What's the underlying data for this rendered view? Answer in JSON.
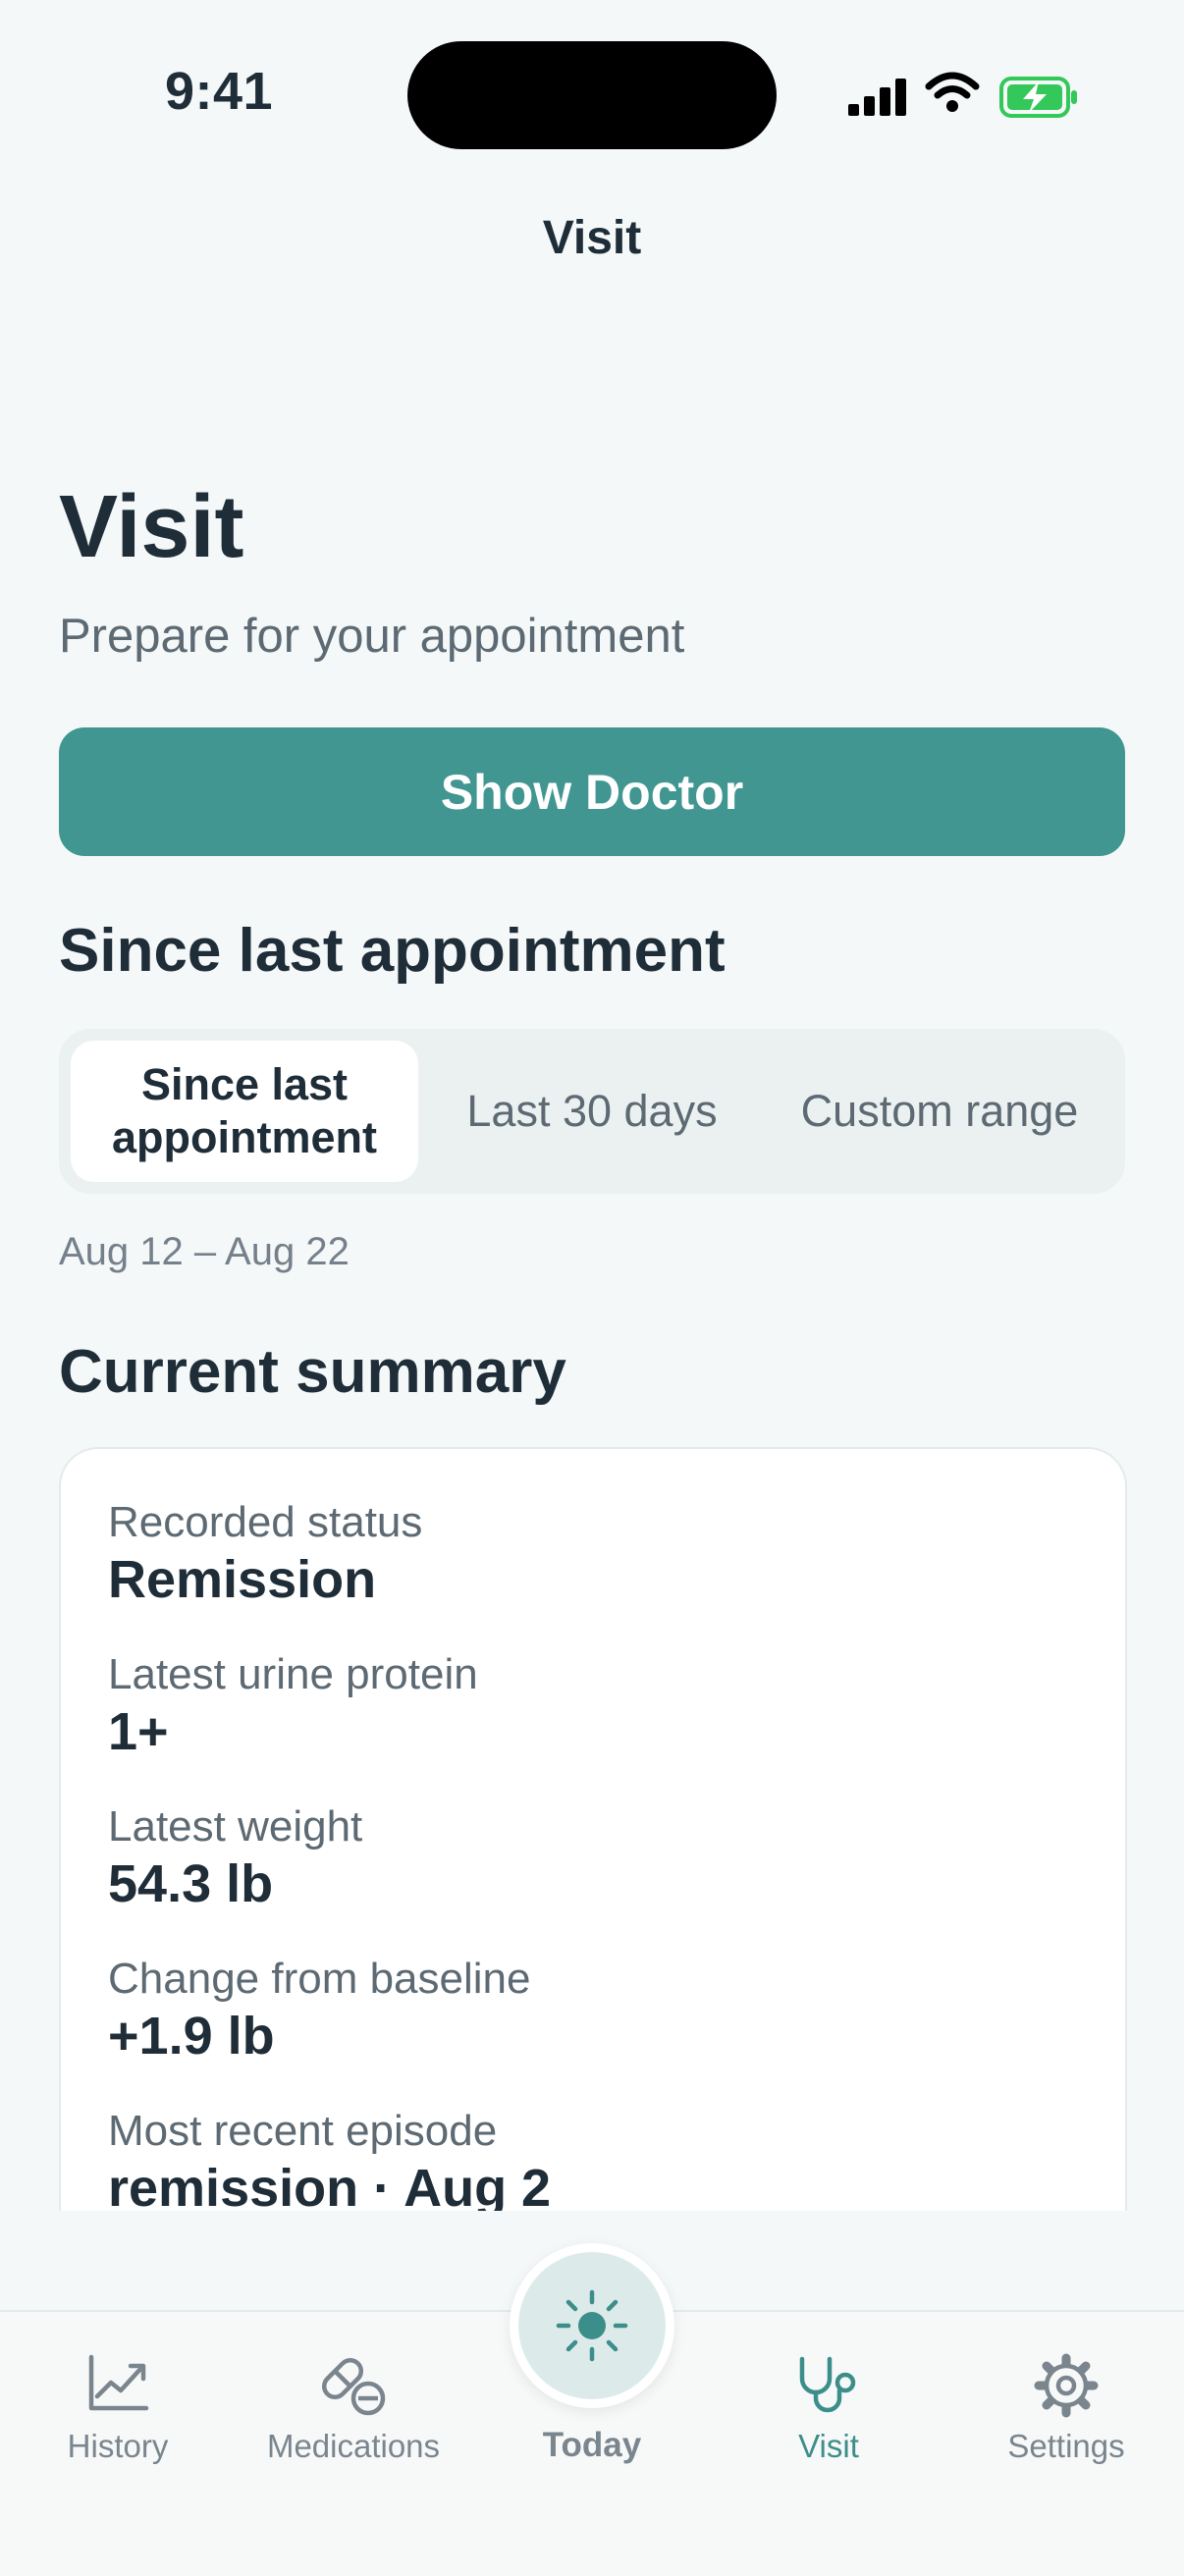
{
  "status_bar": {
    "time": "9:41"
  },
  "header": {
    "title": "Visit"
  },
  "page": {
    "title": "Visit",
    "subtitle": "Prepare for your appointment"
  },
  "actions": {
    "show_doctor": "Show Doctor"
  },
  "range_section": {
    "title": "Since last appointment",
    "options": [
      "Since last appointment",
      "Last 30 days",
      "Custom range"
    ],
    "selected": "Since last appointment",
    "date_range": "Aug 12 – Aug 22"
  },
  "summary": {
    "title": "Current summary",
    "items": [
      {
        "label": "Recorded status",
        "value": "Remission"
      },
      {
        "label": "Latest urine protein",
        "value": "1+"
      },
      {
        "label": "Latest weight",
        "value": "54.3 lb"
      },
      {
        "label": "Change from baseline",
        "value": "+1.9 lb"
      },
      {
        "label": "Most recent episode",
        "value": "remission · Aug 2"
      }
    ]
  },
  "tabbar": {
    "items": [
      {
        "label": "History",
        "icon": "chart-line-icon"
      },
      {
        "label": "Medications",
        "icon": "pills-icon"
      },
      {
        "label": "Today",
        "icon": "sun-icon"
      },
      {
        "label": "Visit",
        "icon": "stethoscope-icon",
        "active": true
      },
      {
        "label": "Settings",
        "icon": "gear-icon"
      }
    ]
  },
  "colors": {
    "accent": "#419691",
    "background": "#f4f8f8",
    "text": "#1f2d38",
    "muted": "#5d6a73",
    "battery": "#34c759"
  }
}
